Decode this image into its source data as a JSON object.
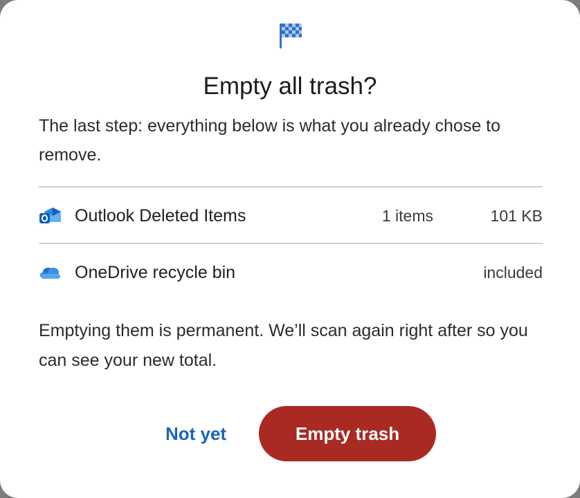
{
  "dialog": {
    "title": "Empty all trash?",
    "intro": "The last step: everything below is what you already chose to remove.",
    "items": [
      {
        "icon": "outlook-icon",
        "name": "Outlook Deleted Items",
        "count": "1 items",
        "size": "101 KB"
      },
      {
        "icon": "onedrive-icon",
        "name": "OneDrive recycle bin",
        "count": "",
        "size": "included"
      }
    ],
    "note": "Emptying them is permanent. We’ll scan again right after so you can see your new total.",
    "cancel_label": "Not yet",
    "confirm_label": "Empty trash"
  },
  "colors": {
    "accent": "#1a66b8",
    "danger": "#a82a23",
    "flag": "#2f72c8"
  }
}
